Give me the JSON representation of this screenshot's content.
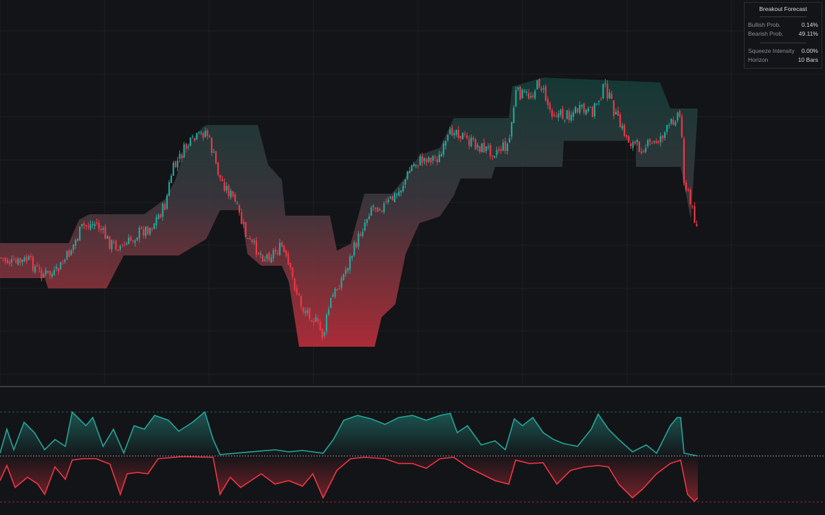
{
  "colors": {
    "background": "#131417",
    "grid": "#1e2026",
    "bull": "#26a69a",
    "bear": "#f23645",
    "band_top": "#184a43",
    "band_bottom": "#c4303d"
  },
  "panel": {
    "title": "Breakout Forecast",
    "bullish_label": "Bullish Prob.",
    "bullish_value": "0.14%",
    "bearish_label": "Bearish Prob.",
    "bearish_value": "49.11%",
    "squeeze_label": "Squeeze Intensity",
    "squeeze_value": "0.00%",
    "horizon_label": "Horizon",
    "horizon_value": "10 Bars"
  },
  "chart_data": [
    {
      "type": "candlestick",
      "description_series": "price",
      "bars": 328,
      "close_path": [
        [
          0,
          375
        ],
        [
          20,
          385
        ],
        [
          40,
          378
        ],
        [
          60,
          398
        ],
        [
          80,
          400
        ],
        [
          100,
          370
        ],
        [
          120,
          330
        ],
        [
          140,
          325
        ],
        [
          160,
          355
        ],
        [
          180,
          360
        ],
        [
          200,
          340
        ],
        [
          220,
          330
        ],
        [
          240,
          300
        ],
        [
          250,
          250
        ],
        [
          270,
          215
        ],
        [
          300,
          190
        ],
        [
          320,
          260
        ],
        [
          340,
          290
        ],
        [
          360,
          350
        ],
        [
          385,
          375
        ],
        [
          410,
          360
        ],
        [
          430,
          420
        ],
        [
          440,
          450
        ],
        [
          450,
          455
        ],
        [
          460,
          470
        ],
        [
          470,
          490
        ],
        [
          480,
          440
        ],
        [
          500,
          400
        ],
        [
          520,
          350
        ],
        [
          540,
          300
        ],
        [
          560,
          300
        ],
        [
          580,
          280
        ],
        [
          600,
          240
        ],
        [
          620,
          230
        ],
        [
          640,
          230
        ],
        [
          660,
          185
        ],
        [
          680,
          205
        ],
        [
          700,
          215
        ],
        [
          720,
          220
        ],
        [
          740,
          210
        ],
        [
          750,
          135
        ],
        [
          770,
          140
        ],
        [
          785,
          120
        ],
        [
          800,
          160
        ],
        [
          820,
          170
        ],
        [
          840,
          160
        ],
        [
          860,
          165
        ],
        [
          880,
          125
        ],
        [
          900,
          180
        ],
        [
          915,
          205
        ],
        [
          930,
          215
        ],
        [
          950,
          210
        ],
        [
          970,
          190
        ],
        [
          985,
          165
        ],
        [
          990,
          170
        ],
        [
          995,
          260
        ],
        [
          1005,
          300
        ],
        [
          1015,
          330
        ]
      ],
      "band_upper_path": [
        [
          0,
          354
        ],
        [
          100,
          354
        ],
        [
          115,
          320
        ],
        [
          130,
          312
        ],
        [
          210,
          312
        ],
        [
          240,
          290
        ],
        [
          255,
          262
        ],
        [
          270,
          215
        ],
        [
          295,
          185
        ],
        [
          300,
          182
        ],
        [
          375,
          182
        ],
        [
          390,
          240
        ],
        [
          410,
          262
        ],
        [
          415,
          314
        ],
        [
          480,
          314
        ],
        [
          490,
          365
        ],
        [
          510,
          355
        ],
        [
          530,
          282
        ],
        [
          570,
          282
        ],
        [
          590,
          258
        ],
        [
          610,
          226
        ],
        [
          640,
          215
        ],
        [
          660,
          172
        ],
        [
          740,
          172
        ],
        [
          745,
          126
        ],
        [
          790,
          113
        ],
        [
          960,
          120
        ],
        [
          975,
          158
        ],
        [
          1015,
          158
        ]
      ],
      "band_lower_path": [
        [
          0,
          405
        ],
        [
          65,
          405
        ],
        [
          70,
          420
        ],
        [
          155,
          420
        ],
        [
          180,
          372
        ],
        [
          260,
          372
        ],
        [
          300,
          348
        ],
        [
          320,
          306
        ],
        [
          350,
          306
        ],
        [
          360,
          370
        ],
        [
          380,
          387
        ],
        [
          410,
          387
        ],
        [
          420,
          410
        ],
        [
          435,
          505
        ],
        [
          545,
          505
        ],
        [
          555,
          462
        ],
        [
          575,
          443
        ],
        [
          590,
          370
        ],
        [
          610,
          325
        ],
        [
          640,
          315
        ],
        [
          660,
          285
        ],
        [
          670,
          260
        ],
        [
          715,
          260
        ],
        [
          720,
          243
        ],
        [
          818,
          243
        ],
        [
          820,
          205
        ],
        [
          925,
          205
        ],
        [
          925,
          243
        ],
        [
          990,
          243
        ],
        [
          1005,
          320
        ]
      ]
    },
    {
      "type": "area",
      "description_series": "probability oscillator",
      "series": [
        {
          "color": "bull",
          "path": [
            [
              0,
              660
            ],
            [
              10,
              625
            ],
            [
              20,
              655
            ],
            [
              35,
              615
            ],
            [
              50,
              630
            ],
            [
              65,
              655
            ],
            [
              80,
              640
            ],
            [
              95,
              650
            ],
            [
              105,
              600
            ],
            [
              125,
              620
            ],
            [
              135,
              608
            ],
            [
              150,
              650
            ],
            [
              165,
              625
            ],
            [
              180,
              660
            ],
            [
              195,
              620
            ],
            [
              210,
              625
            ],
            [
              225,
              605
            ],
            [
              245,
              612
            ],
            [
              260,
              628
            ],
            [
              280,
              615
            ],
            [
              298,
              600
            ],
            [
              310,
              640
            ],
            [
              320,
              662
            ],
            [
              400,
              655
            ],
            [
              420,
              658
            ],
            [
              440,
              656
            ],
            [
              470,
              660
            ],
            [
              485,
              640
            ],
            [
              500,
              612
            ],
            [
              520,
              605
            ],
            [
              540,
              610
            ],
            [
              560,
              618
            ],
            [
              580,
              608
            ],
            [
              600,
              605
            ],
            [
              620,
              612
            ],
            [
              640,
              605
            ],
            [
              655,
              602
            ],
            [
              665,
              630
            ],
            [
              680,
              620
            ],
            [
              700,
              648
            ],
            [
              720,
              642
            ],
            [
              735,
              655
            ],
            [
              748,
              610
            ],
            [
              760,
              620
            ],
            [
              775,
              608
            ],
            [
              790,
              630
            ],
            [
              805,
              640
            ],
            [
              820,
              646
            ],
            [
              840,
              650
            ],
            [
              860,
              625
            ],
            [
              870,
              603
            ],
            [
              885,
              625
            ],
            [
              900,
              640
            ],
            [
              920,
              658
            ],
            [
              940,
              648
            ],
            [
              955,
              660
            ],
            [
              975,
              620
            ],
            [
              985,
              608
            ],
            [
              990,
              608
            ],
            [
              995,
              660
            ],
            [
              1015,
              664
            ]
          ]
        },
        {
          "color": "bear",
          "path": [
            [
              0,
              700
            ],
            [
              10,
              678
            ],
            [
              22,
              710
            ],
            [
              40,
              695
            ],
            [
              55,
              705
            ],
            [
              65,
              720
            ],
            [
              80,
              680
            ],
            [
              95,
              698
            ],
            [
              105,
              670
            ],
            [
              120,
              668
            ],
            [
              140,
              668
            ],
            [
              160,
              676
            ],
            [
              175,
              720
            ],
            [
              185,
              690
            ],
            [
              200,
              688
            ],
            [
              215,
              690
            ],
            [
              230,
              668
            ],
            [
              265,
              665
            ],
            [
              310,
              666
            ],
            [
              320,
              720
            ],
            [
              335,
              695
            ],
            [
              350,
              710
            ],
            [
              365,
              700
            ],
            [
              380,
              690
            ],
            [
              400,
              705
            ],
            [
              420,
              700
            ],
            [
              440,
              708
            ],
            [
              455,
              690
            ],
            [
              470,
              725
            ],
            [
              490,
              685
            ],
            [
              510,
              668
            ],
            [
              530,
              666
            ],
            [
              560,
              668
            ],
            [
              580,
              675
            ],
            [
              600,
              675
            ],
            [
              620,
              682
            ],
            [
              640,
              668
            ],
            [
              660,
              666
            ],
            [
              680,
              680
            ],
            [
              700,
              690
            ],
            [
              720,
              700
            ],
            [
              740,
              705
            ],
            [
              750,
              670
            ],
            [
              770,
              675
            ],
            [
              790,
              674
            ],
            [
              810,
              705
            ],
            [
              830,
              685
            ],
            [
              850,
              680
            ],
            [
              870,
              678
            ],
            [
              885,
              680
            ],
            [
              900,
              705
            ],
            [
              920,
              725
            ],
            [
              935,
              712
            ],
            [
              955,
              690
            ],
            [
              975,
              675
            ],
            [
              990,
              670
            ],
            [
              1000,
              720
            ],
            [
              1010,
              730
            ],
            [
              1015,
              725
            ]
          ]
        }
      ]
    }
  ]
}
